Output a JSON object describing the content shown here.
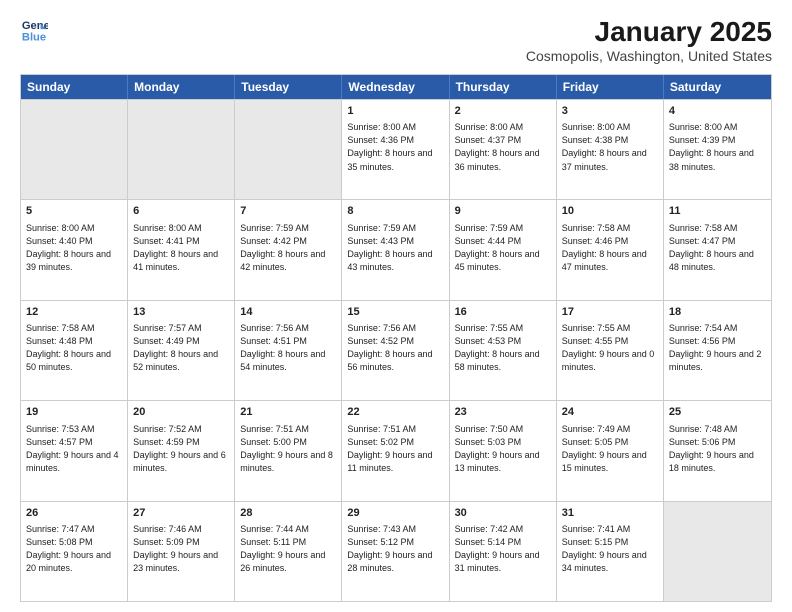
{
  "header": {
    "logo_line1": "General",
    "logo_line2": "Blue",
    "main_title": "January 2025",
    "subtitle": "Cosmopolis, Washington, United States"
  },
  "days_of_week": [
    "Sunday",
    "Monday",
    "Tuesday",
    "Wednesday",
    "Thursday",
    "Friday",
    "Saturday"
  ],
  "weeks": [
    [
      {
        "day": "",
        "empty": true
      },
      {
        "day": "",
        "empty": true
      },
      {
        "day": "",
        "empty": true
      },
      {
        "day": "1",
        "text": "Sunrise: 8:00 AM\nSunset: 4:36 PM\nDaylight: 8 hours\nand 35 minutes."
      },
      {
        "day": "2",
        "text": "Sunrise: 8:00 AM\nSunset: 4:37 PM\nDaylight: 8 hours\nand 36 minutes."
      },
      {
        "day": "3",
        "text": "Sunrise: 8:00 AM\nSunset: 4:38 PM\nDaylight: 8 hours\nand 37 minutes."
      },
      {
        "day": "4",
        "text": "Sunrise: 8:00 AM\nSunset: 4:39 PM\nDaylight: 8 hours\nand 38 minutes."
      }
    ],
    [
      {
        "day": "5",
        "text": "Sunrise: 8:00 AM\nSunset: 4:40 PM\nDaylight: 8 hours\nand 39 minutes."
      },
      {
        "day": "6",
        "text": "Sunrise: 8:00 AM\nSunset: 4:41 PM\nDaylight: 8 hours\nand 41 minutes."
      },
      {
        "day": "7",
        "text": "Sunrise: 7:59 AM\nSunset: 4:42 PM\nDaylight: 8 hours\nand 42 minutes."
      },
      {
        "day": "8",
        "text": "Sunrise: 7:59 AM\nSunset: 4:43 PM\nDaylight: 8 hours\nand 43 minutes."
      },
      {
        "day": "9",
        "text": "Sunrise: 7:59 AM\nSunset: 4:44 PM\nDaylight: 8 hours\nand 45 minutes."
      },
      {
        "day": "10",
        "text": "Sunrise: 7:58 AM\nSunset: 4:46 PM\nDaylight: 8 hours\nand 47 minutes."
      },
      {
        "day": "11",
        "text": "Sunrise: 7:58 AM\nSunset: 4:47 PM\nDaylight: 8 hours\nand 48 minutes."
      }
    ],
    [
      {
        "day": "12",
        "text": "Sunrise: 7:58 AM\nSunset: 4:48 PM\nDaylight: 8 hours\nand 50 minutes."
      },
      {
        "day": "13",
        "text": "Sunrise: 7:57 AM\nSunset: 4:49 PM\nDaylight: 8 hours\nand 52 minutes."
      },
      {
        "day": "14",
        "text": "Sunrise: 7:56 AM\nSunset: 4:51 PM\nDaylight: 8 hours\nand 54 minutes."
      },
      {
        "day": "15",
        "text": "Sunrise: 7:56 AM\nSunset: 4:52 PM\nDaylight: 8 hours\nand 56 minutes."
      },
      {
        "day": "16",
        "text": "Sunrise: 7:55 AM\nSunset: 4:53 PM\nDaylight: 8 hours\nand 58 minutes."
      },
      {
        "day": "17",
        "text": "Sunrise: 7:55 AM\nSunset: 4:55 PM\nDaylight: 9 hours\nand 0 minutes."
      },
      {
        "day": "18",
        "text": "Sunrise: 7:54 AM\nSunset: 4:56 PM\nDaylight: 9 hours\nand 2 minutes."
      }
    ],
    [
      {
        "day": "19",
        "text": "Sunrise: 7:53 AM\nSunset: 4:57 PM\nDaylight: 9 hours\nand 4 minutes."
      },
      {
        "day": "20",
        "text": "Sunrise: 7:52 AM\nSunset: 4:59 PM\nDaylight: 9 hours\nand 6 minutes."
      },
      {
        "day": "21",
        "text": "Sunrise: 7:51 AM\nSunset: 5:00 PM\nDaylight: 9 hours\nand 8 minutes."
      },
      {
        "day": "22",
        "text": "Sunrise: 7:51 AM\nSunset: 5:02 PM\nDaylight: 9 hours\nand 11 minutes."
      },
      {
        "day": "23",
        "text": "Sunrise: 7:50 AM\nSunset: 5:03 PM\nDaylight: 9 hours\nand 13 minutes."
      },
      {
        "day": "24",
        "text": "Sunrise: 7:49 AM\nSunset: 5:05 PM\nDaylight: 9 hours\nand 15 minutes."
      },
      {
        "day": "25",
        "text": "Sunrise: 7:48 AM\nSunset: 5:06 PM\nDaylight: 9 hours\nand 18 minutes."
      }
    ],
    [
      {
        "day": "26",
        "text": "Sunrise: 7:47 AM\nSunset: 5:08 PM\nDaylight: 9 hours\nand 20 minutes."
      },
      {
        "day": "27",
        "text": "Sunrise: 7:46 AM\nSunset: 5:09 PM\nDaylight: 9 hours\nand 23 minutes."
      },
      {
        "day": "28",
        "text": "Sunrise: 7:44 AM\nSunset: 5:11 PM\nDaylight: 9 hours\nand 26 minutes."
      },
      {
        "day": "29",
        "text": "Sunrise: 7:43 AM\nSunset: 5:12 PM\nDaylight: 9 hours\nand 28 minutes."
      },
      {
        "day": "30",
        "text": "Sunrise: 7:42 AM\nSunset: 5:14 PM\nDaylight: 9 hours\nand 31 minutes."
      },
      {
        "day": "31",
        "text": "Sunrise: 7:41 AM\nSunset: 5:15 PM\nDaylight: 9 hours\nand 34 minutes."
      },
      {
        "day": "",
        "empty": true
      }
    ]
  ]
}
